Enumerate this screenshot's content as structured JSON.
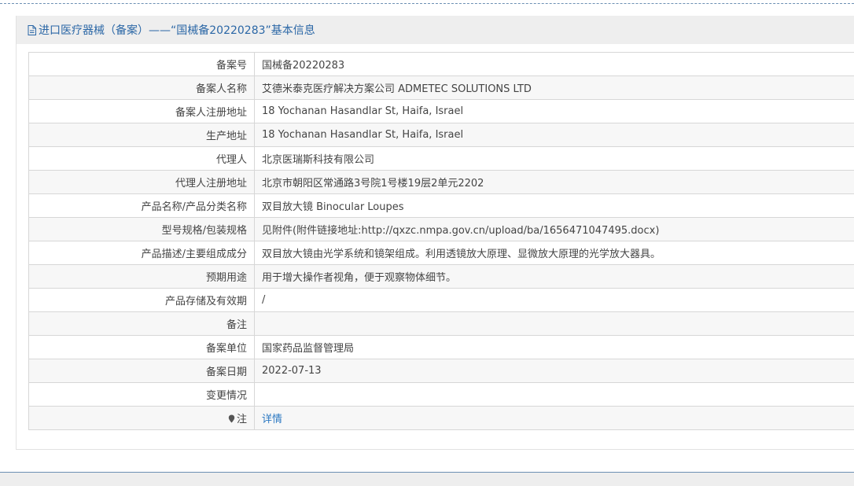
{
  "panel": {
    "title": "进口医疗器械（备案）——“国械备20220283”基本信息",
    "title_icon": "document-icon"
  },
  "rows": [
    {
      "label": "备案号",
      "value": "国械备20220283"
    },
    {
      "label": "备案人名称",
      "value": "艾德米泰克医疗解决方案公司 ADMETEC SOLUTIONS LTD"
    },
    {
      "label": "备案人注册地址",
      "value": "18 Yochanan Hasandlar St, Haifa, Israel"
    },
    {
      "label": "生产地址",
      "value": "18 Yochanan Hasandlar St, Haifa, Israel"
    },
    {
      "label": "代理人",
      "value": "北京医瑞斯科技有限公司"
    },
    {
      "label": "代理人注册地址",
      "value": "北京市朝阳区常通路3号院1号楼19层2单元2202"
    },
    {
      "label": "产品名称/产品分类名称",
      "value": "双目放大镜 Binocular Loupes"
    },
    {
      "label": "型号规格/包装规格",
      "value": "见附件(附件链接地址:http://qxzc.nmpa.gov.cn/upload/ba/1656471047495.docx)"
    },
    {
      "label": "产品描述/主要组成成分",
      "value": "双目放大镜由光学系统和镜架组成。利用透镜放大原理、显微放大原理的光学放大器具。"
    },
    {
      "label": "预期用途",
      "value": "用于增大操作者视角，便于观察物体细节。"
    },
    {
      "label": "产品存储及有效期",
      "value": " /"
    },
    {
      "label": "备注",
      "value": ""
    },
    {
      "label": "备案单位",
      "value": "国家药品监督管理局"
    },
    {
      "label": "备案日期",
      "value": "2022-07-13"
    },
    {
      "label": "变更情况",
      "value": ""
    }
  ],
  "note_row": {
    "label": "注",
    "label_icon": "pin-icon",
    "link_text": "详情"
  },
  "colors": {
    "title": "#2b67a6",
    "link": "#2b78c2",
    "header_bg": "#eeeeee",
    "border": "#d7d7d7"
  }
}
